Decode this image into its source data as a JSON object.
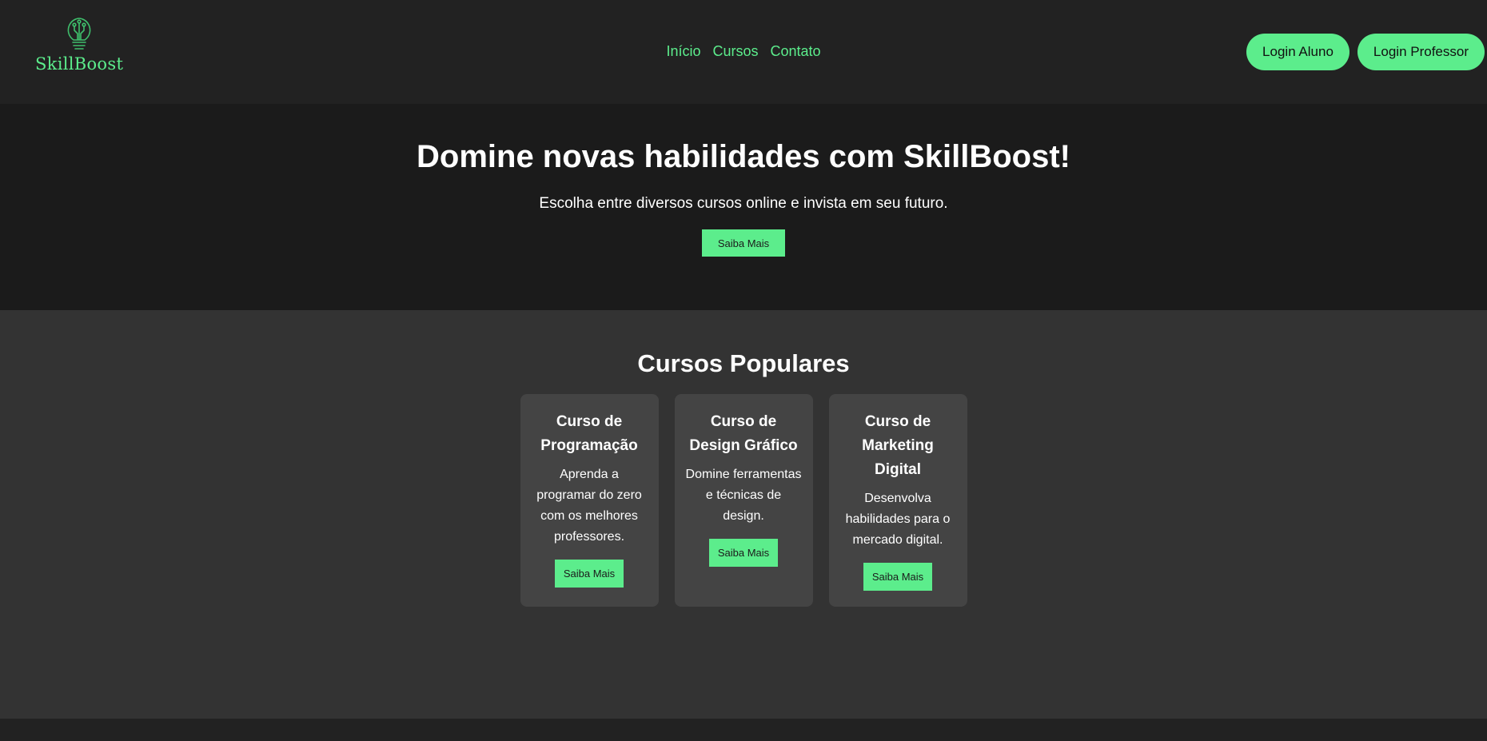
{
  "brand": {
    "name": "SkillBoost",
    "color": "#5ced8c"
  },
  "nav": {
    "items": [
      "Início",
      "Cursos",
      "Contato"
    ]
  },
  "auth": {
    "student_login": "Login Aluno",
    "teacher_login": "Login Professor"
  },
  "hero": {
    "title": "Domine novas habilidades com SkillBoost!",
    "subtitle": "Escolha entre diversos cursos online e invista em seu futuro.",
    "cta": "Saiba Mais"
  },
  "courses": {
    "title": "Cursos Populares",
    "items": [
      {
        "title": "Curso de Programação",
        "description": "Aprenda a programar do zero com os melhores professores.",
        "cta": "Saiba Mais"
      },
      {
        "title": "Curso de Design Gráfico",
        "description": "Domine ferramentas e técnicas de design.",
        "cta": "Saiba Mais"
      },
      {
        "title": "Curso de Marketing Digital",
        "description": "Desenvolva habilidades para o mercado digital.",
        "cta": "Saiba Mais"
      }
    ]
  },
  "icons": {
    "logo": "lightbulb-circuit-icon"
  },
  "colors": {
    "accent": "#5ced8c",
    "header_bg": "#222222",
    "hero_bg": "#1b1b1b",
    "section_bg": "#333333",
    "card_bg": "#444444"
  }
}
